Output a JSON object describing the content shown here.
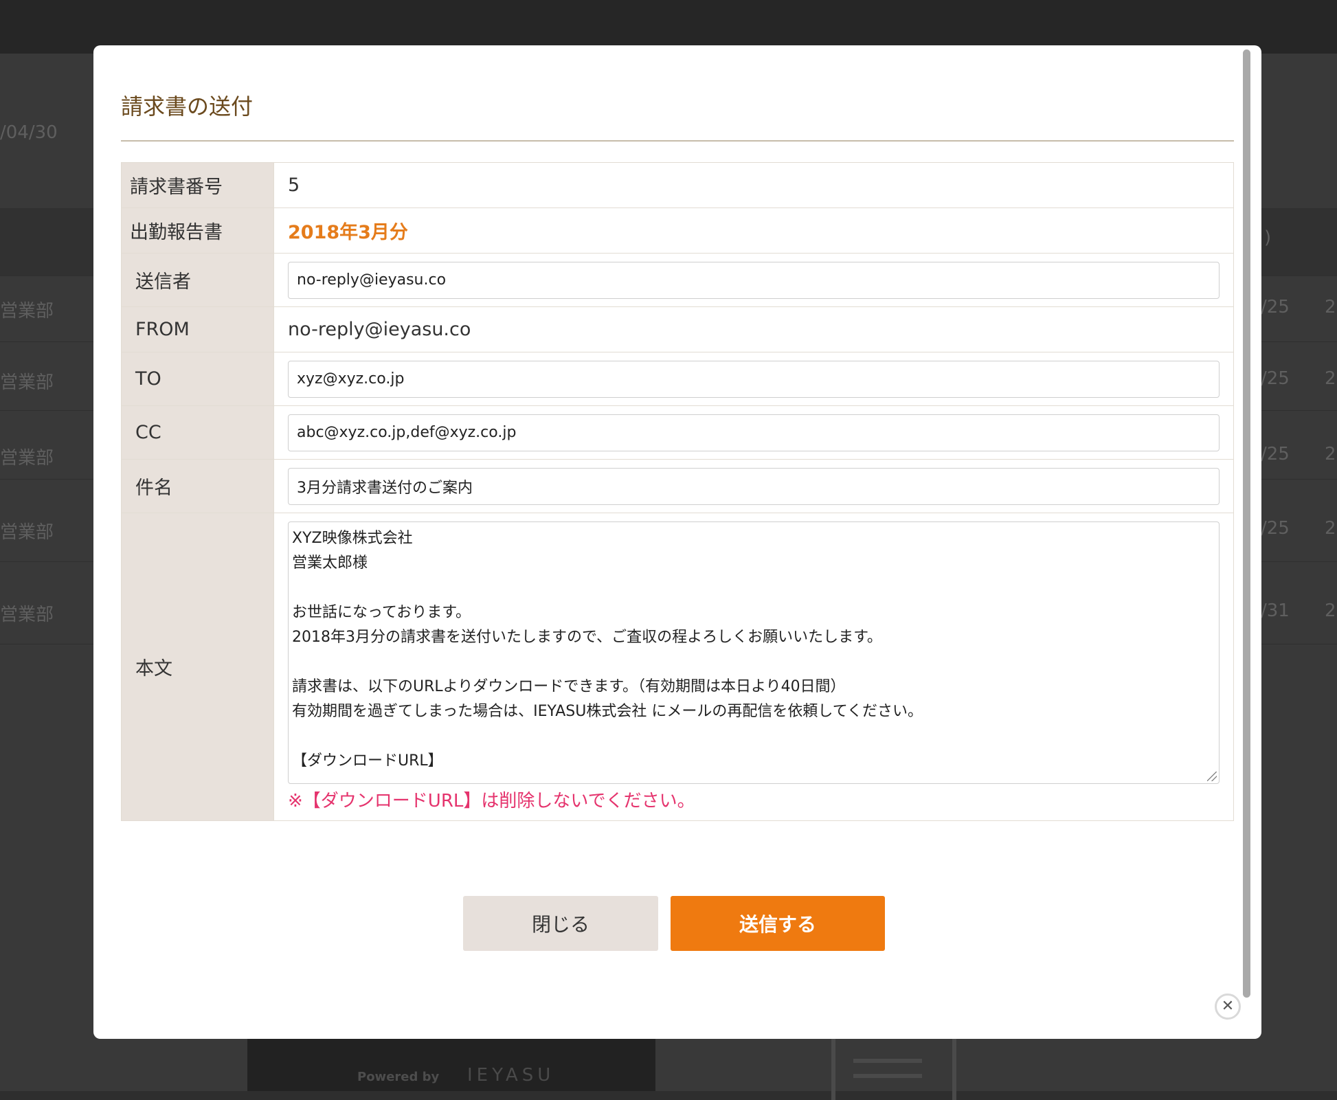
{
  "background": {
    "date_fragment": "/04/30",
    "rows": [
      {
        "dept": "営業部",
        "date_fragment": "/25",
        "extra": "2"
      },
      {
        "dept": "営業部",
        "date_fragment": "/25",
        "extra": "2"
      },
      {
        "dept": "営業部",
        "date_fragment": "/25",
        "extra": "2"
      },
      {
        "dept": "営業部",
        "date_fragment": "/25",
        "extra": "2"
      },
      {
        "dept": "営業部",
        "date_fragment": "/31",
        "extra": "2"
      }
    ],
    "header_fragment": ")",
    "powered_by": "Powered by",
    "logo_text": "IEYASU"
  },
  "modal": {
    "title": "請求書の送付",
    "fields": {
      "invoice_no": {
        "label": "請求書番号",
        "value": "5"
      },
      "attendance_report": {
        "label": "出勤報告書",
        "value": "2018年3月分"
      },
      "sender": {
        "label": "送信者",
        "value": "no-reply@ieyasu.co"
      },
      "from": {
        "label": "FROM",
        "value": "no-reply@ieyasu.co"
      },
      "to": {
        "label": "TO",
        "value": "xyz@xyz.co.jp"
      },
      "cc": {
        "label": "CC",
        "value": "abc@xyz.co.jp,def@xyz.co.jp"
      },
      "subject": {
        "label": "件名",
        "value": "3月分請求書送付のご案内"
      },
      "body": {
        "label": "本文",
        "value": "XYZ映像株式会社\n営業太郎様\n\nお世話になっております。\n2018年3月分の請求書を送付いたしますので、ご査収の程よろしくお願いいたします。\n\n請求書は、以下のURLよりダウンロードできます。（有効期間は本日より40日間）\n有効期間を過ぎてしまった場合は、IEYASU株式会社 にメールの再配信を依頼してください。\n\n【ダウンロードURL】",
        "warning": "※【ダウンロードURL】は削除しないでください。"
      }
    },
    "buttons": {
      "close": "閉じる",
      "send": "送信する"
    },
    "close_icon_glyph": "✕"
  },
  "colors": {
    "accent": "#ef7a10",
    "warning": "#e5336d",
    "label_bg": "#e8e1db",
    "title": "#6b4a1e"
  }
}
